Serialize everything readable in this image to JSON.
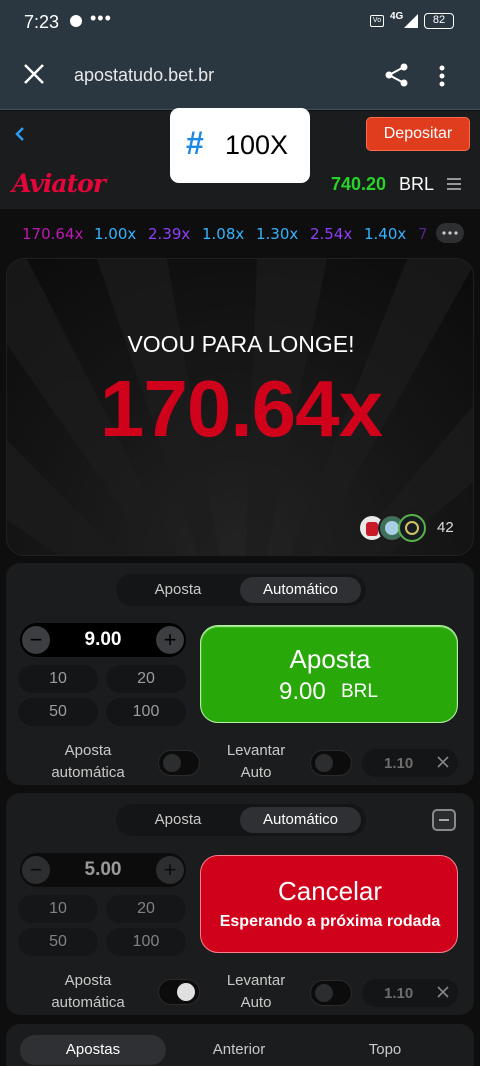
{
  "status": {
    "time": "7:23",
    "network": "4G",
    "battery": "82"
  },
  "browser": {
    "url": "apostatudo.bet.br"
  },
  "header": {
    "deposit_label": "Depositar",
    "badge_hash": "#",
    "badge_text": "100X"
  },
  "game": {
    "logo": "Aviator",
    "balance": "740.20",
    "currency": "BRL"
  },
  "history": [
    "170.64x",
    "1.00x",
    "2.39x",
    "1.08x",
    "1.30x",
    "2.54x",
    "1.40x",
    "7"
  ],
  "stage": {
    "flew_text": "VOOU PARA LONGE!",
    "multiplier": "170.64x",
    "players": "42"
  },
  "panel1": {
    "tabs": [
      "Aposta",
      "Automático"
    ],
    "amount": "9.00",
    "quick": [
      "10",
      "20",
      "50",
      "100"
    ],
    "action_title": "Aposta",
    "action_amount": "9.00",
    "action_currency": "BRL",
    "auto_bet_label": "Aposta automática",
    "auto_cash_label": "Levantar Auto",
    "cashout_value": "1.10"
  },
  "panel2": {
    "tabs": [
      "Aposta",
      "Automático"
    ],
    "amount": "5.00",
    "quick": [
      "10",
      "20",
      "50",
      "100"
    ],
    "action_title": "Cancelar",
    "action_sub": "Esperando a próxima rodada",
    "auto_bet_label": "Aposta automática",
    "auto_cash_label": "Levantar Auto",
    "cashout_value": "1.10"
  },
  "bottom_tabs": [
    "Apostas",
    "Anterior",
    "Topo"
  ],
  "colors": {
    "green": "#28a909",
    "red": "#d0021b",
    "deposit": "#e03c1e",
    "balance": "#28d228"
  }
}
